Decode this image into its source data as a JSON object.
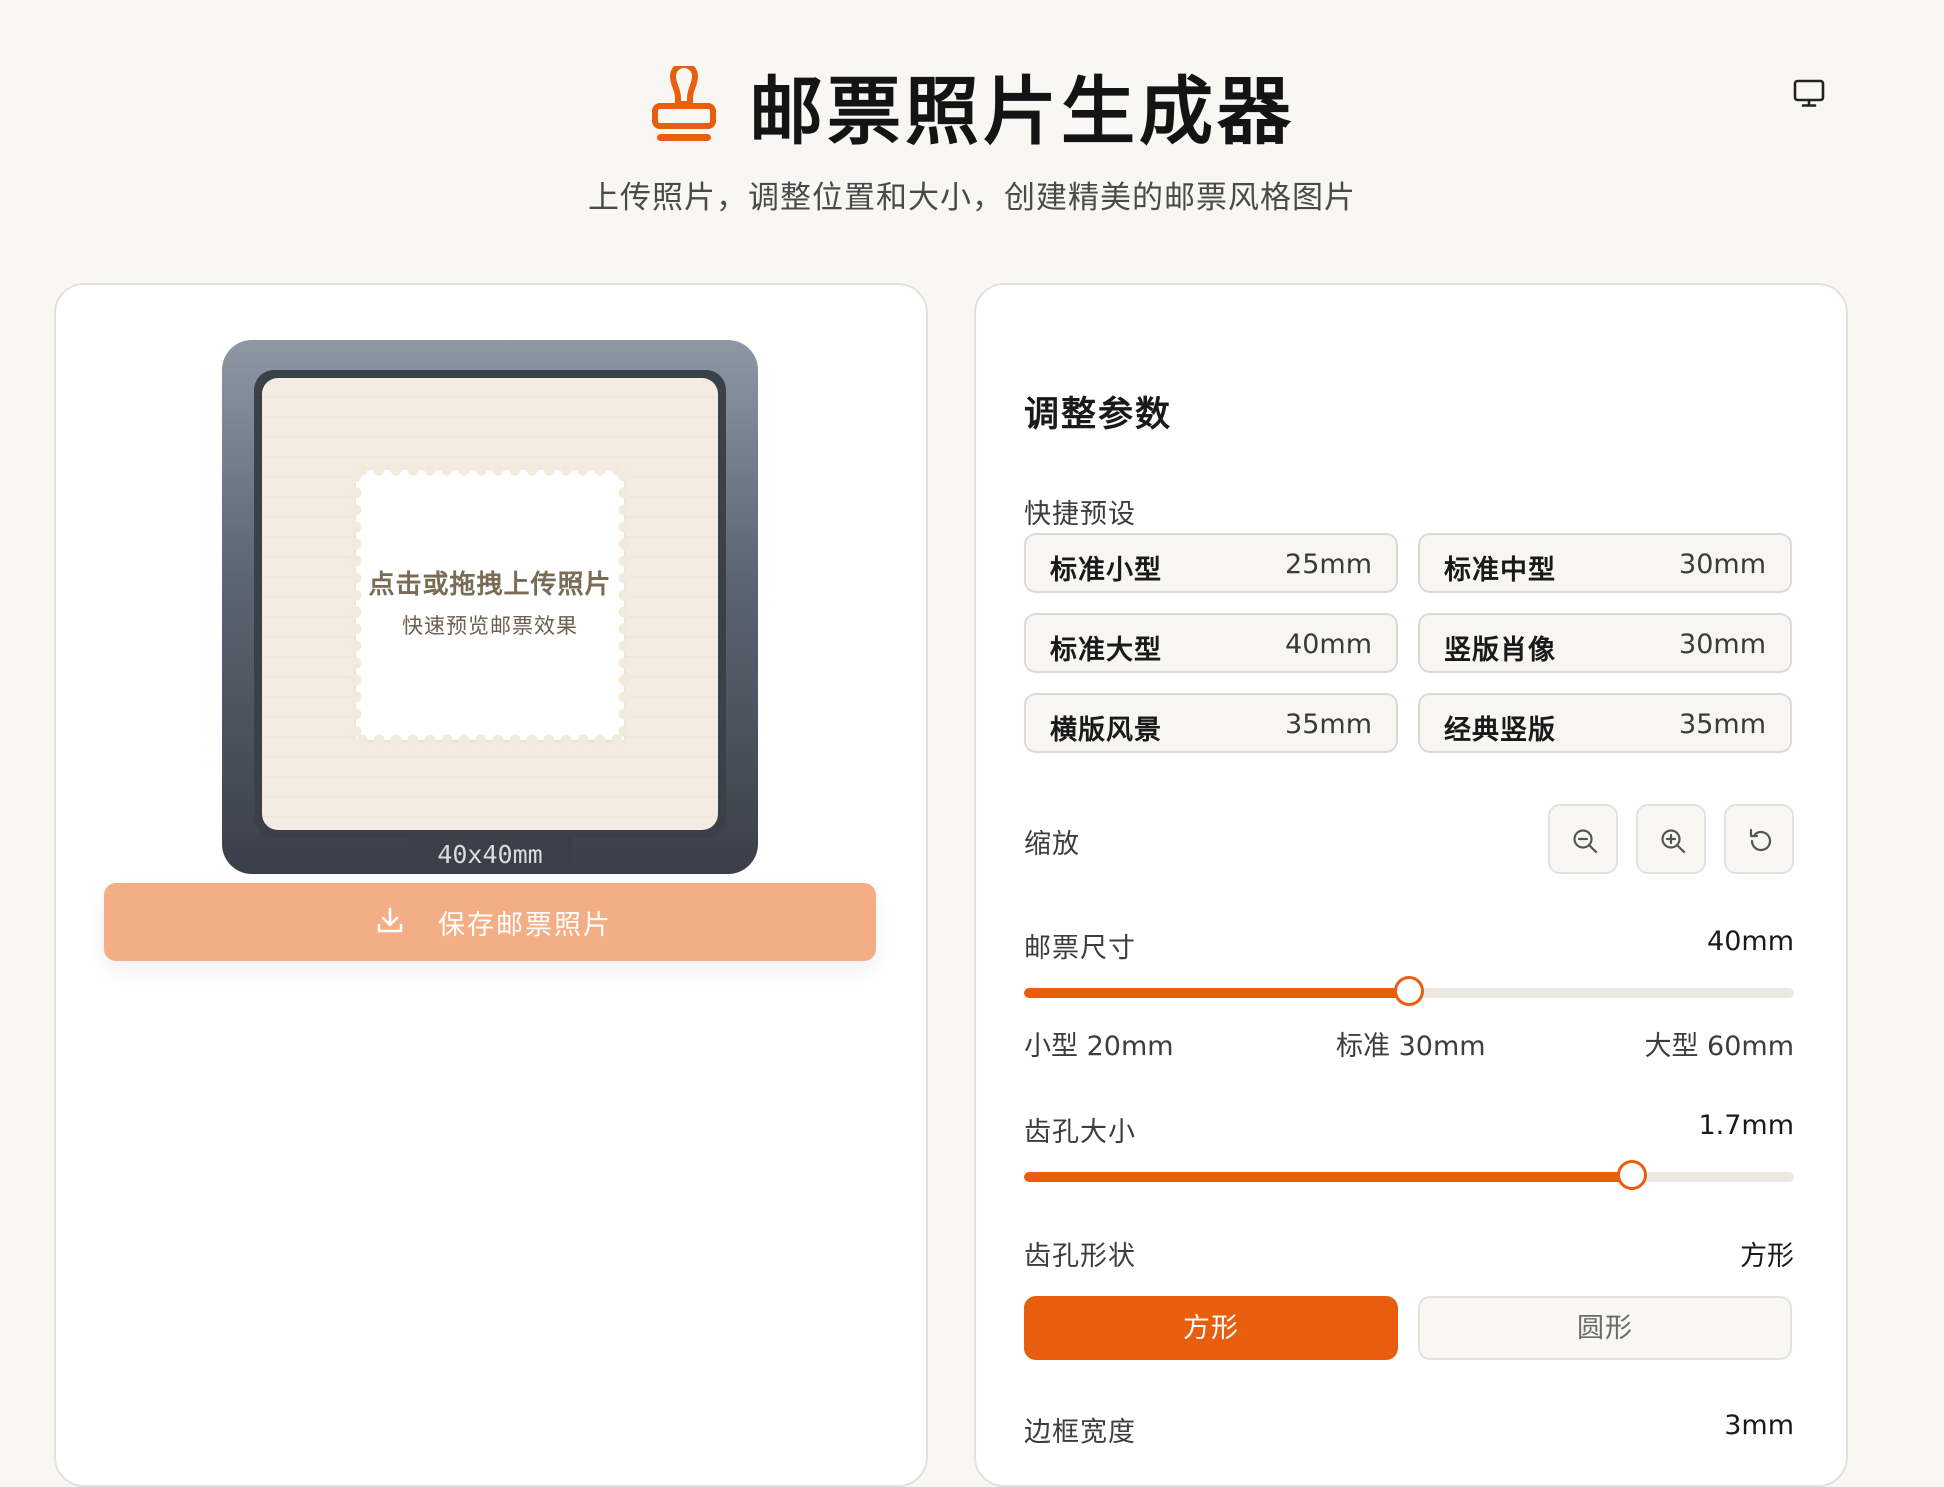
{
  "header": {
    "title": "邮票照片生成器",
    "subtitle": "上传照片，调整位置和大小，创建精美的邮票风格图片",
    "title_icon": "stamp-icon",
    "display_toggle_icon": "monitor-icon"
  },
  "preview": {
    "upload_main": "点击或拖拽上传照片",
    "upload_sub": "快速预览邮票效果",
    "size_label": "40x40mm",
    "save_button": "保存邮票照片",
    "save_icon": "download-icon"
  },
  "params": {
    "title": "调整参数",
    "presets_label": "快捷预设",
    "presets": [
      {
        "name": "标准小型",
        "size": "25mm"
      },
      {
        "name": "标准中型",
        "size": "30mm"
      },
      {
        "name": "标准大型",
        "size": "40mm"
      },
      {
        "name": "竖版肖像",
        "size": "30mm"
      },
      {
        "name": "横版风景",
        "size": "35mm"
      },
      {
        "name": "经典竖版",
        "size": "35mm"
      }
    ],
    "zoom_label": "缩放",
    "zoom_icons": [
      "zoom-out-icon",
      "zoom-in-icon",
      "reset-icon"
    ],
    "stamp_size": {
      "label": "邮票尺寸",
      "value_text": "40mm",
      "value": 40,
      "min": 20,
      "max": 60,
      "ticks": [
        "小型 20mm",
        "标准 30mm",
        "大型 60mm"
      ]
    },
    "perforation_size": {
      "label": "齿孔大小",
      "value_text": "1.7mm",
      "fraction": 0.79
    },
    "perforation_shape": {
      "label": "齿孔形状",
      "value_text": "方形",
      "options": [
        "方形",
        "圆形"
      ],
      "selected": "方形"
    },
    "border_width": {
      "label": "边框宽度",
      "value_text": "3mm"
    }
  },
  "colors": {
    "accent": "#e85d0e",
    "save_button": "#f3ae85",
    "background": "#f8f7f4"
  }
}
